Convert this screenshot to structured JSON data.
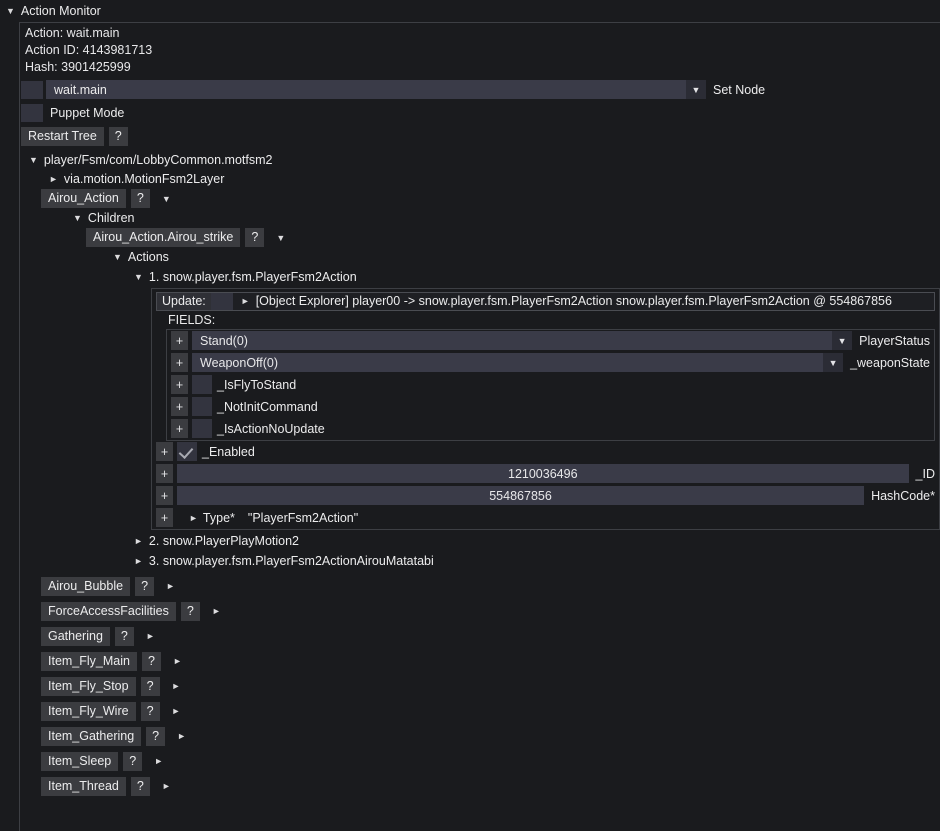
{
  "header": {
    "title": "Action Monitor",
    "caret": "▼"
  },
  "info": {
    "action": "Action: wait.main",
    "action_id": "Action ID: 4143981713",
    "hash": "Hash: 3901425999"
  },
  "node_select": {
    "value": "wait.main",
    "arrow": "▼",
    "side_label": "Set Node"
  },
  "puppet": {
    "label": "Puppet Mode"
  },
  "toolbar": {
    "restart_label": "Restart Tree",
    "help_label": "?"
  },
  "tree": {
    "root": {
      "caret": "▼",
      "label": "player/Fsm/com/LobbyCommon.motfsm2"
    },
    "layer": {
      "caret": "►",
      "label": "via.motion.MotionFsm2Layer"
    },
    "airou_action": {
      "label": "Airou_Action",
      "help": "?",
      "caret": "▼"
    },
    "children": {
      "caret": "▼",
      "label": "Children"
    },
    "airou_strike": {
      "label": "Airou_Action.Airou_strike",
      "help": "?",
      "caret": "▼"
    },
    "actions": {
      "caret": "▼",
      "label": "Actions"
    },
    "action1": {
      "caret": "▼",
      "label": "1. snow.player.fsm.PlayerFsm2Action"
    },
    "action2": {
      "caret": "►",
      "label": "2. snow.PlayerPlayMotion2"
    },
    "action3": {
      "caret": "►",
      "label": "3. snow.player.fsm.PlayerFsm2ActionAirouMatatabi"
    }
  },
  "update_row": {
    "label": "Update:",
    "caret": "►",
    "text": "[Object Explorer]  player00 -> snow.player.fsm.PlayerFsm2Action snow.player.fsm.PlayerFsm2Action @ 554867856"
  },
  "fields": {
    "heading": "FIELDS:",
    "plus": "+",
    "arrow": "▼",
    "inner_rows": [
      {
        "kind": "combo",
        "value": "Stand(0)",
        "name": "PlayerStatus"
      },
      {
        "kind": "combo",
        "value": "WeaponOff(0)",
        "name": "_weaponState"
      },
      {
        "kind": "check",
        "checked": false,
        "name": "_IsFlyToStand"
      },
      {
        "kind": "check",
        "checked": false,
        "name": "_NotInitCommand"
      },
      {
        "kind": "check",
        "checked": false,
        "name": "_IsActionNoUpdate"
      }
    ],
    "outer_rows": [
      {
        "kind": "check",
        "checked": true,
        "name": "_Enabled"
      },
      {
        "kind": "value",
        "value": "1210036496",
        "name": "_ID"
      },
      {
        "kind": "value",
        "value": "554867856",
        "name": "HashCode*"
      },
      {
        "kind": "type",
        "caret": "►",
        "name": "Type*",
        "value": "\"PlayerFsm2Action\""
      }
    ]
  },
  "bottom_nodes": [
    {
      "label": "Airou_Bubble",
      "help": "?",
      "caret": "►"
    },
    {
      "label": "ForceAccessFacilities",
      "help": "?",
      "caret": "►"
    },
    {
      "label": "Gathering",
      "help": "?",
      "caret": "►"
    },
    {
      "label": "Item_Fly_Main",
      "help": "?",
      "caret": "►"
    },
    {
      "label": "Item_Fly_Stop",
      "help": "?",
      "caret": "►"
    },
    {
      "label": "Item_Fly_Wire",
      "help": "?",
      "caret": "►"
    },
    {
      "label": "Item_Gathering",
      "help": "?",
      "caret": "►"
    },
    {
      "label": "Item_Sleep",
      "help": "?",
      "caret": "►"
    },
    {
      "label": "Item_Thread",
      "help": "?",
      "caret": "►"
    }
  ],
  "colors": {
    "background": "#1a1b1e",
    "field": "#3a3b48",
    "button": "#3b3c40",
    "border": "#3d3f44"
  }
}
